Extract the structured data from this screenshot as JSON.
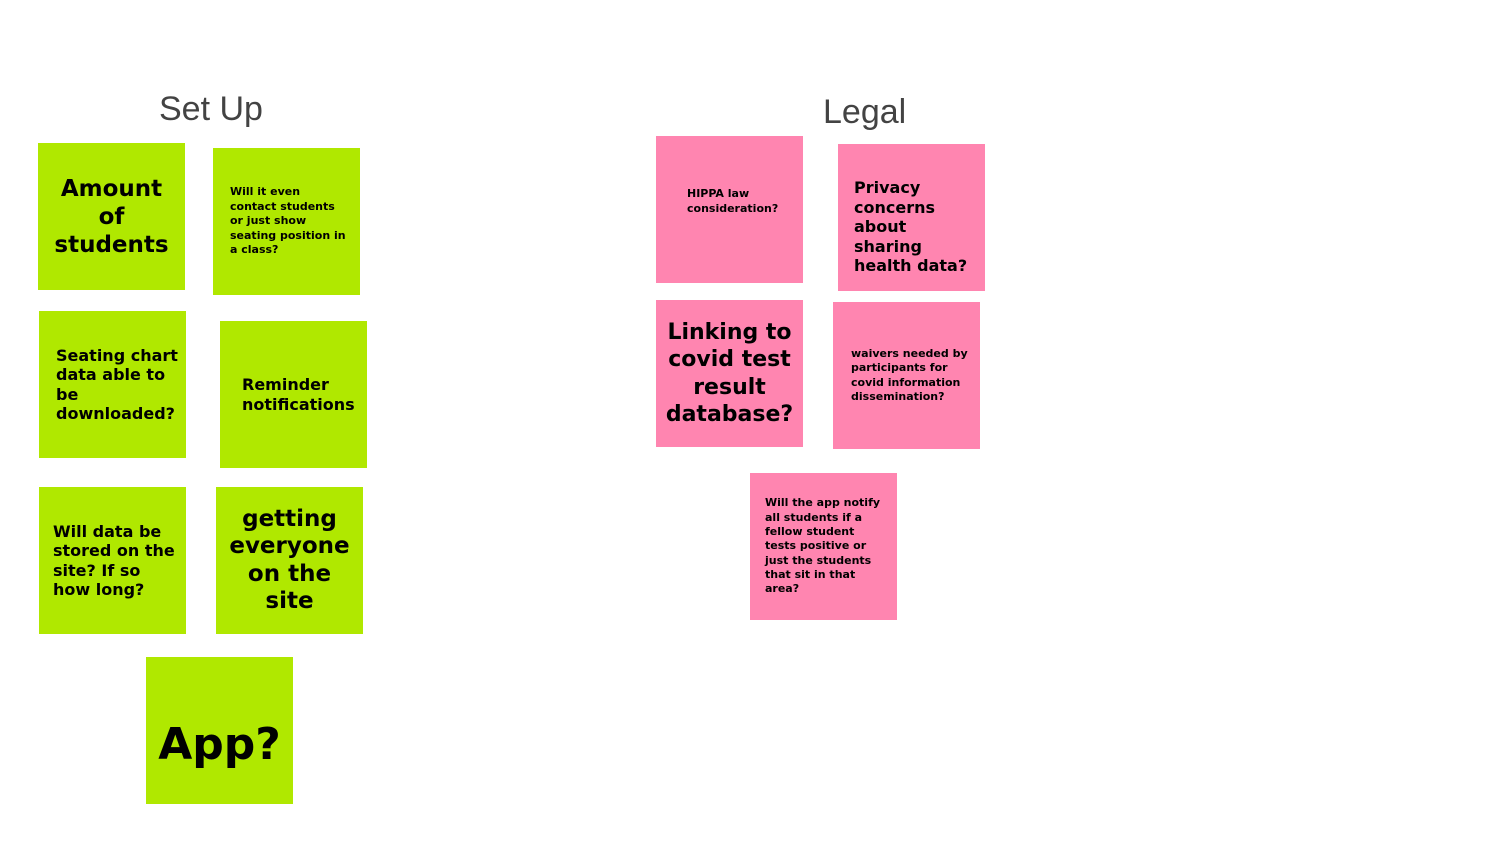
{
  "colors": {
    "setup_note": "#b0e800",
    "legal_note": "#ff85b0",
    "heading": "#434343",
    "background": "#ffffff"
  },
  "groups": {
    "setup": {
      "title": "Set Up",
      "notes": [
        "Amount of students",
        "Will it even contact students or just show seating position in a class?",
        "Seating chart data able to be downloaded?",
        "Reminder notifications",
        "Will data be stored on the site? If so how long?",
        "getting everyone on the site",
        "App?"
      ]
    },
    "legal": {
      "title": "Legal",
      "notes": [
        "HIPPA law consideration?",
        "Privacy concerns about sharing health data?",
        "Linking to covid test result database?",
        "waivers needed by participants for covid information dissemination?",
        "Will the app notify all students if a fellow student tests positive or just the students that sit in that area?"
      ]
    }
  }
}
